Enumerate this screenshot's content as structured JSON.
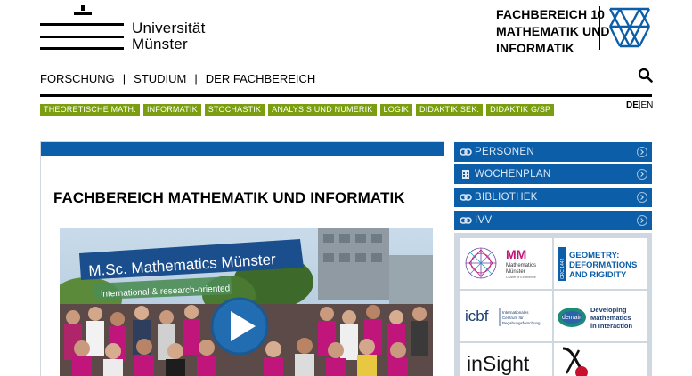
{
  "header": {
    "university_line1": "Universität",
    "university_line2": "Münster",
    "faculty_line1": "FACHBEREICH 10",
    "faculty_line2": "MATHEMATIK UND",
    "faculty_line3": "INFORMATIK"
  },
  "nav": {
    "items": [
      "FORSCHUNG",
      "STUDIUM",
      "DER FACHBEREICH"
    ],
    "separator": "|"
  },
  "tags": [
    "THEORETISCHE MATH.",
    "INFORMATIK",
    "STOCHASTIK",
    "ANALYSIS UND NUMERIK",
    "LOGIK",
    "DIDAKTIK SEK.",
    "DIDAKTIK G/SP"
  ],
  "language": {
    "active": "DE",
    "separator": "|",
    "other": "EN"
  },
  "main": {
    "title": "FACHBEREICH MATHEMATIK UND INFORMATIK",
    "video": {
      "headline": "M.Sc. Mathematics Münster",
      "subline": "international & research-oriented"
    }
  },
  "sidebar": {
    "links": [
      "PERSONEN",
      "WOCHENPLAN",
      "BIBLIOTHEK",
      "IVV"
    ],
    "icons": [
      "link-icon",
      "calendar-icon",
      "link-icon",
      "link-icon"
    ]
  },
  "partners": {
    "mm": {
      "letters": "MM",
      "line1": "Mathematics",
      "line2": "Münster",
      "line3": "Cluster of Excellence"
    },
    "geometry": {
      "side": "CRC 1442",
      "line1": "GEOMETRY:",
      "line2": "DEFORMATIONS",
      "line3": "AND RIGIDITY"
    },
    "icbf": {
      "letters": "icbf",
      "line1": "Internationales",
      "line2": "Centrum für",
      "line3": "Begabungsforschung"
    },
    "demain": {
      "badge": "demain",
      "line1": "Developing",
      "line2": "Mathematics",
      "line3": "in Interaction"
    },
    "insight": {
      "text": "inSight"
    }
  },
  "colors": {
    "primary_blue": "#0c5ea8",
    "tag_green": "#7a9e0f",
    "mm_pink": "#c0157a"
  }
}
